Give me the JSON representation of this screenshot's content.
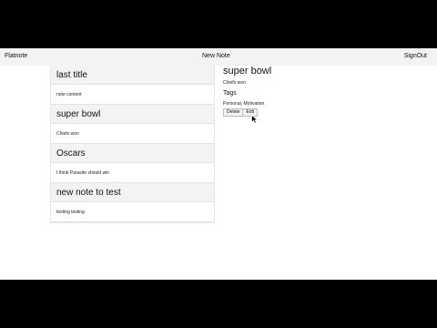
{
  "navbar": {
    "brand": "Flatnote",
    "new_note": "New Note",
    "sign_out": "SignOut"
  },
  "notes": [
    {
      "title": "last title",
      "content": "note content"
    },
    {
      "title": "super bowl",
      "content": "Chiefs won"
    },
    {
      "title": "Oscars",
      "content": "I think Parasite should win"
    },
    {
      "title": "new note to test",
      "content": "testing testing"
    }
  ],
  "detail": {
    "title": "super bowl",
    "content": "Chiefs won",
    "tags_heading": "Tags",
    "tags": "Personal, Motivation",
    "delete_label": "Delete",
    "edit_label": "Edit"
  },
  "icons": {
    "cursor": "mouse-pointer-icon"
  }
}
